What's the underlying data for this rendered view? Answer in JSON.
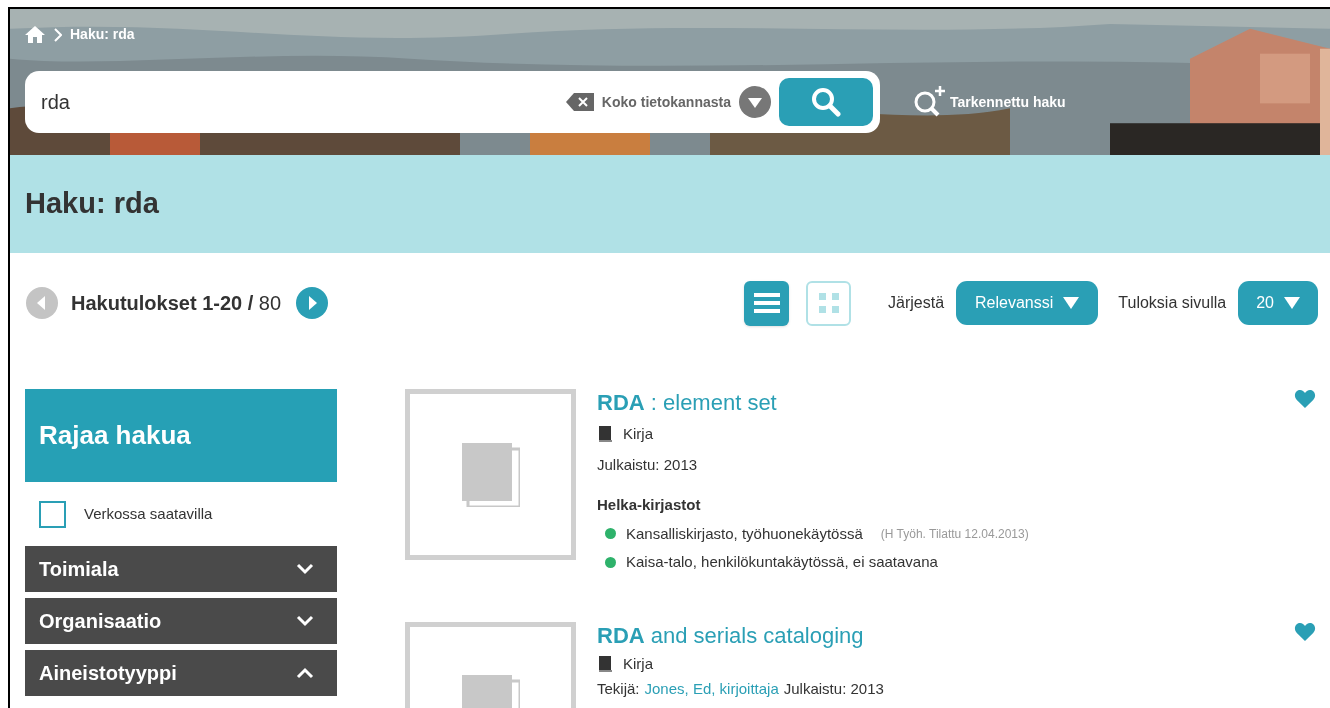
{
  "breadcrumb": {
    "items": [
      "Haku: rda"
    ]
  },
  "search": {
    "value": "rda",
    "scope": "Koko tietokannasta",
    "advanced_link": "Tarkennettu haku"
  },
  "page_title": "Haku: rda",
  "results_bar": {
    "label": "Hakutulokset 1-20 / ",
    "total": "80",
    "prev_disabled": true,
    "next_disabled": false,
    "view_modes": [
      {
        "kind": "list",
        "selected": true
      },
      {
        "kind": "grid",
        "selected": false
      }
    ],
    "sort_label": "Järjestä",
    "sort_value": "Relevanssi",
    "per_page_label": "Tuloksia sivulla",
    "per_page_value": "20"
  },
  "sidebar": {
    "title": "Rajaa hakua",
    "online_filter": {
      "label": "Verkossa saatavilla",
      "checked": false
    },
    "facets": [
      {
        "label": "Toimiala",
        "expanded": false
      },
      {
        "label": "Organisaatio",
        "expanded": false
      },
      {
        "label": "Aineistotyyppi",
        "expanded": true
      }
    ]
  },
  "results": [
    {
      "title": "**RDA** : element set",
      "format": "Kirja",
      "meta": [
        {
          "kind": "text",
          "text": "Julkaistu: 2013"
        }
      ],
      "holdings": {
        "group": "Helka-kirjastot",
        "items": [
          {
            "text": "Kansalliskirjasto, työhuonekäytössä",
            "note": "(H Työh. Tilattu 12.04.2013)",
            "color": "#2eb26b"
          },
          {
            "text": "Kaisa-talo, henkilökuntakäytössä, ei saatavana",
            "color": "#2eb26b"
          }
        ]
      }
    },
    {
      "title": "**RDA** and serials cataloging",
      "format": "Kirja",
      "meta": [
        {
          "kind": "text",
          "text": "Tekijä:"
        },
        {
          "kind": "link",
          "text": "Jones, Ed, kirjoittaja"
        },
        {
          "kind": "text",
          "text": "Julkaistu: 2013"
        }
      ]
    }
  ]
}
